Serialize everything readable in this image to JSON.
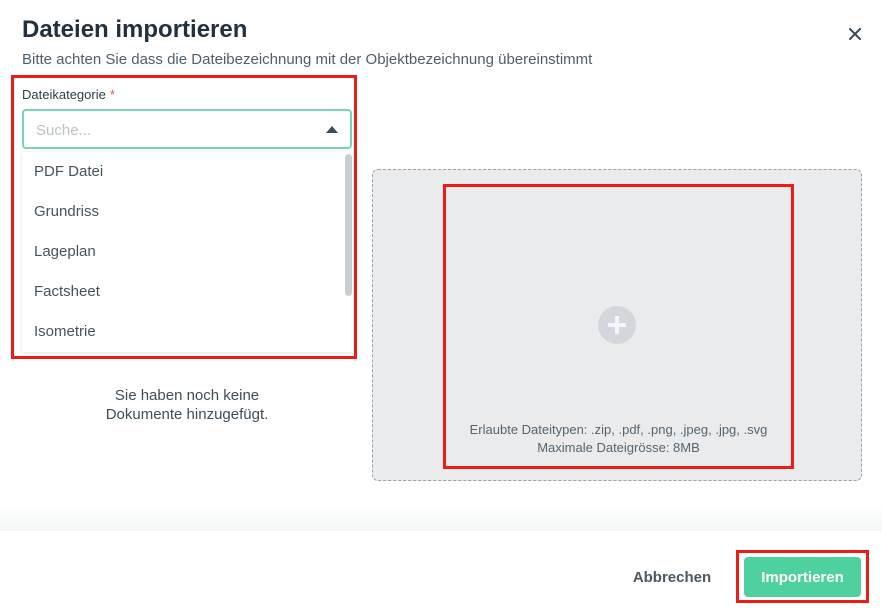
{
  "dialog": {
    "title": "Dateien importieren",
    "subtitle": "Bitte achten Sie dass die Dateibezeichnung mit der Objektbezeichnung übereinstimmt",
    "close_label": "×"
  },
  "category": {
    "label": "Dateikategorie",
    "required_mark": "*",
    "placeholder": "Suche...",
    "options": [
      "PDF Datei",
      "Grundriss",
      "Lageplan",
      "Factsheet",
      "Isometrie"
    ]
  },
  "documents": {
    "empty_line1": "Sie haben noch keine",
    "empty_line2": "Dokumente hinzugefügt."
  },
  "dropzone": {
    "allowed_types": "Erlaubte Dateitypen: .zip, .pdf, .png, .jpeg, .jpg, .svg",
    "max_size": "Maximale Dateigrösse: 8MB"
  },
  "footer": {
    "cancel_label": "Abbrechen",
    "import_label": "Importieren"
  },
  "colors": {
    "accent": "#4fd19f",
    "input_focus_border": "#7ad2b8",
    "highlight": "#ee1c16",
    "dropzone_bg": "#e9ebed"
  },
  "icons": {
    "close": "close-icon",
    "caret": "caret-up-icon",
    "upload": "plus-circle-icon"
  }
}
